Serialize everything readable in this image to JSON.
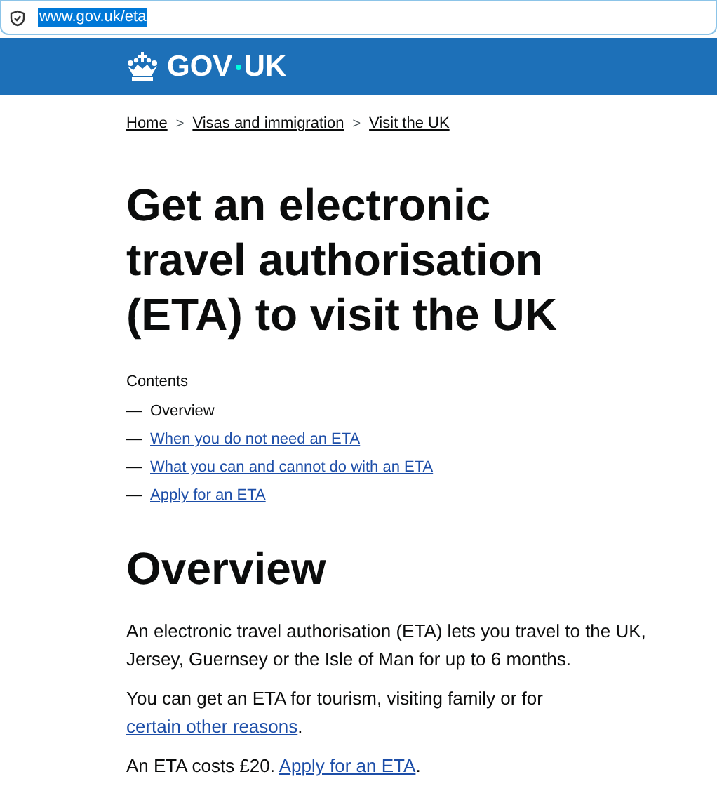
{
  "address_bar": {
    "url": "www.gov.uk/eta"
  },
  "header": {
    "logo_text": "GOV",
    "logo_text_2": "UK"
  },
  "breadcrumbs": [
    {
      "label": "Home",
      "separator": ">"
    },
    {
      "label": "Visas and immigration",
      "separator": ">"
    },
    {
      "label": "Visit the UK"
    }
  ],
  "title": "Get an electronic travel authorisation (ETA) to visit the UK",
  "contents": {
    "heading": "Contents",
    "items": [
      {
        "marker": "—",
        "label": "Overview",
        "selected": true
      },
      {
        "marker": "—",
        "label": "When you do not need an ETA",
        "selected": false
      },
      {
        "marker": "—",
        "label": "What you can and cannot do with an ETA",
        "selected": false
      },
      {
        "marker": "—",
        "label": "Apply for an ETA",
        "selected": false
      }
    ]
  },
  "section_heading": "Overview",
  "paragraphs": [
    [
      {
        "kind": "text",
        "text": "An electronic travel authorisation (ETA) lets you travel to the UK, Jersey, Guernsey or the Isle of Man for up to 6 months."
      }
    ],
    [
      {
        "kind": "text",
        "text": "You can get an ETA for tourism, visiting family or for "
      },
      {
        "kind": "link",
        "text": "certain other reasons"
      },
      {
        "kind": "text",
        "text": "."
      }
    ],
    [
      {
        "kind": "text",
        "text": "An ETA costs £20. "
      },
      {
        "kind": "link",
        "text": "Apply for an ETA"
      },
      {
        "kind": "text",
        "text": "."
      }
    ]
  ]
}
